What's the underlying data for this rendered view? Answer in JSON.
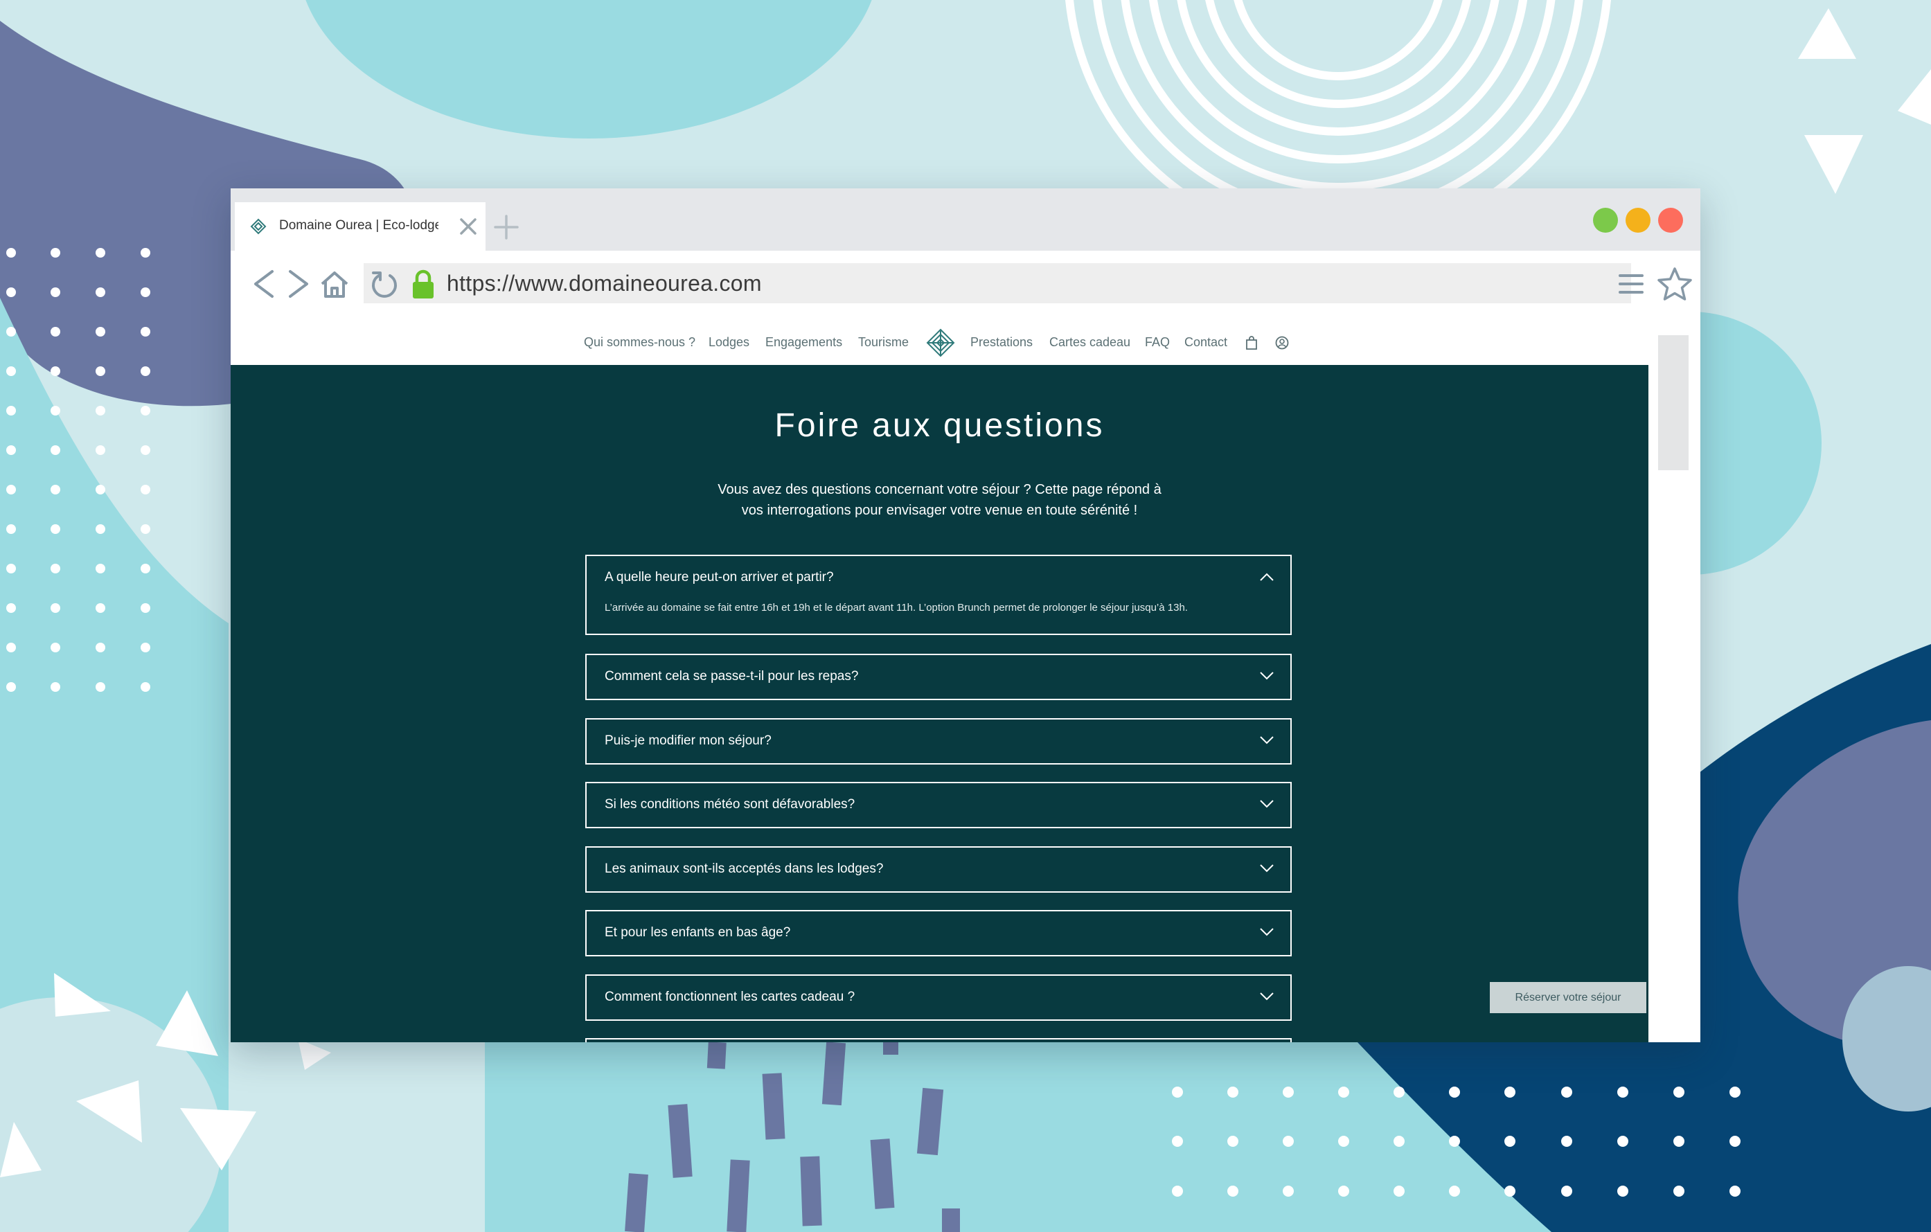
{
  "browser": {
    "tab_title": "Domaine Ourea | Eco-lodge a",
    "url": "https://www.domaineourea.com"
  },
  "site_nav": {
    "links": [
      "Qui sommes-nous ?",
      "Lodges",
      "Engagements",
      "Tourisme",
      "Prestations",
      "Cartes cadeau",
      "FAQ",
      "Contact"
    ]
  },
  "faq": {
    "title": "Foire aux questions",
    "intro_line1": "Vous avez des questions concernant votre séjour ? Cette page répond à",
    "intro_line2": "vos interrogations pour envisager votre venue en toute sérénité !",
    "items": [
      {
        "question": "A quelle heure peut-on arriver et partir?",
        "answer": "L’arrivée au domaine se fait entre 16h et 19h et le départ avant 11h. L’option Brunch permet de prolonger le séjour jusqu’à 13h.",
        "expanded": true
      },
      {
        "question": "Comment cela se passe-t-il pour les repas?",
        "expanded": false
      },
      {
        "question": "Puis-je modifier mon séjour?",
        "expanded": false
      },
      {
        "question": "Si les conditions météo sont défavorables?",
        "expanded": false
      },
      {
        "question": "Les animaux sont-ils acceptés dans les lodges?",
        "expanded": false
      },
      {
        "question": "Et pour les enfants en bas âge?",
        "expanded": false
      },
      {
        "question": "Comment fonctionnent les cartes cadeau ?",
        "expanded": false
      }
    ],
    "book_button": "Réserver votre séjour"
  },
  "colors": {
    "hero_bg": "#083a40",
    "bg_light": "#cfe9ec",
    "bg_teal": "#9adbe1",
    "bg_purple": "#6a77a2",
    "bg_navy": "#064574"
  }
}
